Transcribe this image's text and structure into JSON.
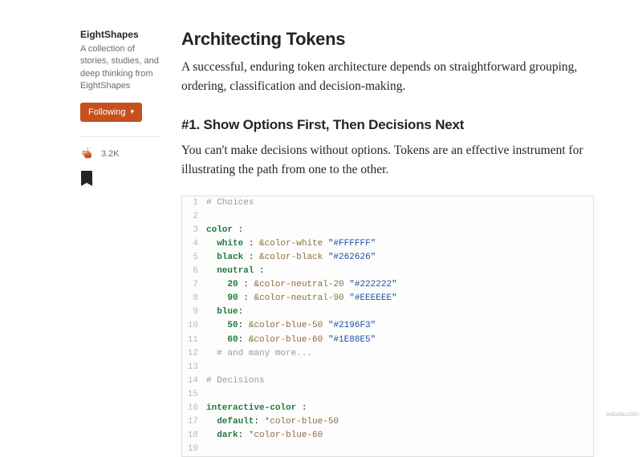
{
  "sidebar": {
    "publication": "EightShapes",
    "description": "A collection of stories, studies, and deep thinking from EightShapes",
    "follow_label": "Following",
    "clap_count": "3.2K"
  },
  "article": {
    "title": "Architecting Tokens",
    "intro": "A successful, enduring token architecture depends on straightforward grouping, ordering, classification and decision-making.",
    "section1_heading": "#1. Show Options First, Then Decisions Next",
    "section1_body": "You can't make decisions without options. Tokens are an effective instrument for illustrating the path from one to the other."
  },
  "code": {
    "lines": [
      [
        {
          "t": "# Choices",
          "c": "cm"
        }
      ],
      [],
      [
        {
          "t": "color",
          "c": "key"
        },
        {
          "t": " :",
          "c": ""
        }
      ],
      [
        {
          "t": "  "
        },
        {
          "t": "white",
          "c": "key"
        },
        {
          "t": " : "
        },
        {
          "t": "&color-white",
          "c": "anchor"
        },
        {
          "t": " "
        },
        {
          "t": "\"#FFFFFF\"",
          "c": "str"
        }
      ],
      [
        {
          "t": "  "
        },
        {
          "t": "black",
          "c": "key"
        },
        {
          "t": " : "
        },
        {
          "t": "&color-black",
          "c": "anchor"
        },
        {
          "t": " "
        },
        {
          "t": "\"#262626\"",
          "c": "str"
        }
      ],
      [
        {
          "t": "  "
        },
        {
          "t": "neutral",
          "c": "key"
        },
        {
          "t": " :"
        }
      ],
      [
        {
          "t": "    "
        },
        {
          "t": "20",
          "c": "key"
        },
        {
          "t": " : "
        },
        {
          "t": "&color-neutral-20",
          "c": "anchor"
        },
        {
          "t": " "
        },
        {
          "t": "\"#222222\"",
          "c": "str"
        }
      ],
      [
        {
          "t": "    "
        },
        {
          "t": "90",
          "c": "key"
        },
        {
          "t": " : "
        },
        {
          "t": "&color-neutral-90",
          "c": "anchor"
        },
        {
          "t": " "
        },
        {
          "t": "\"#EEEEEE\"",
          "c": "str"
        }
      ],
      [
        {
          "t": "  "
        },
        {
          "t": "blue",
          "c": "key"
        },
        {
          "t": ":"
        }
      ],
      [
        {
          "t": "    "
        },
        {
          "t": "50",
          "c": "key"
        },
        {
          "t": ": "
        },
        {
          "t": "&color-blue-50",
          "c": "anchor"
        },
        {
          "t": " "
        },
        {
          "t": "\"#2196F3\"",
          "c": "str"
        }
      ],
      [
        {
          "t": "    "
        },
        {
          "t": "60",
          "c": "key"
        },
        {
          "t": ": "
        },
        {
          "t": "&color-blue-60",
          "c": "anchor"
        },
        {
          "t": " "
        },
        {
          "t": "\"#1E88E5\"",
          "c": "str"
        }
      ],
      [
        {
          "t": "  "
        },
        {
          "t": "# and many more...",
          "c": "cm"
        }
      ],
      [],
      [
        {
          "t": "# Decisions",
          "c": "cm"
        }
      ],
      [],
      [
        {
          "t": "interactive-color",
          "c": "key"
        },
        {
          "t": " :"
        }
      ],
      [
        {
          "t": "  "
        },
        {
          "t": "default",
          "c": "key"
        },
        {
          "t": ": "
        },
        {
          "t": "*color-blue-50",
          "c": "anchor"
        }
      ],
      [
        {
          "t": "  "
        },
        {
          "t": "dark",
          "c": "key"
        },
        {
          "t": ": "
        },
        {
          "t": "*color-blue-60",
          "c": "anchor"
        }
      ],
      []
    ]
  },
  "attribution": "wduda.com"
}
